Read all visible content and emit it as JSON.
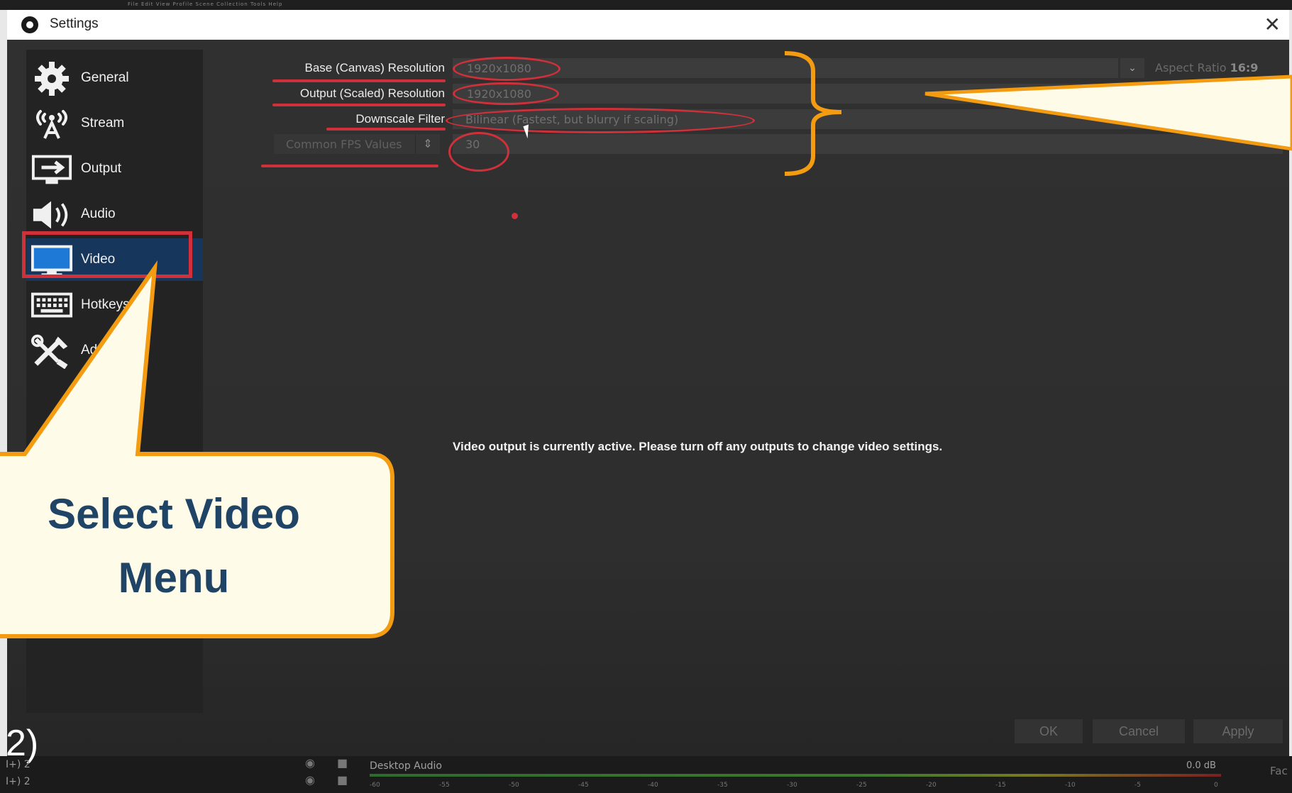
{
  "app": {
    "menu_strip": "File   Edit   View   Profile   Scene Collection   Tools   Help"
  },
  "window": {
    "title": "Settings",
    "close_symbol": "✕"
  },
  "sidebar": {
    "items": [
      {
        "label": "General",
        "icon": "gear-icon"
      },
      {
        "label": "Stream",
        "icon": "broadcast-icon"
      },
      {
        "label": "Output",
        "icon": "output-icon"
      },
      {
        "label": "Audio",
        "icon": "speaker-icon"
      },
      {
        "label": "Video",
        "icon": "monitor-icon",
        "active": true
      },
      {
        "label": "Hotkeys",
        "icon": "keyboard-icon"
      },
      {
        "label": "Advanced",
        "icon": "tools-icon"
      }
    ]
  },
  "video": {
    "base_label": "Base (Canvas) Resolution",
    "base_value": "1920x1080",
    "aspect_label": "Aspect Ratio",
    "aspect_value": "16:9",
    "output_label": "Output (Scaled) Resolution",
    "output_value": "1920x1080",
    "filter_label": "Downscale Filter",
    "filter_value": "Bilinear (Fastest, but blurry if scaling)",
    "fps_type": "Common FPS Values",
    "fps_value": "30",
    "notice": "Video output is currently active. Please turn off any outputs to change video settings."
  },
  "buttons": {
    "ok": "OK",
    "cancel": "Cancel",
    "apply": "Apply"
  },
  "mixer": {
    "channel_label": "Desktop Audio",
    "db": "0.0 dB",
    "channels": [
      "I+) 2",
      "I+) 2"
    ],
    "ticks": [
      "-60",
      "-55",
      "-50",
      "-45",
      "-40",
      "-35",
      "-30",
      "-25",
      "-20",
      "-15",
      "-10",
      "-5",
      "0"
    ],
    "side": "Fac"
  },
  "annotation": {
    "callout_line1": "Select Video",
    "callout_line2": "Menu",
    "step": "2)"
  },
  "colors": {
    "accent_orange": "#f39c12",
    "highlight_red": "#d0303a",
    "active_nav": "#17365b",
    "callout_text": "#1f4466"
  }
}
